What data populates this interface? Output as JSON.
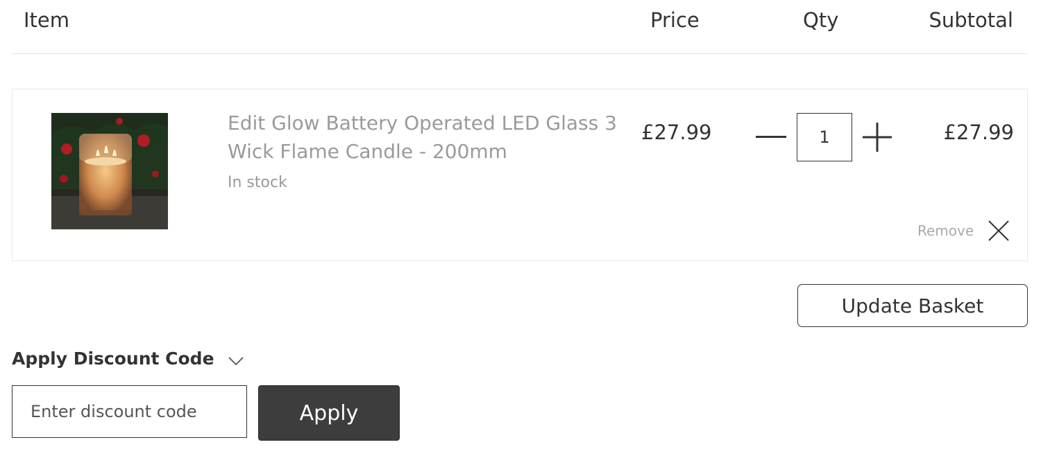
{
  "table_header": {
    "item": "Item",
    "price": "Price",
    "qty": "Qty",
    "subtotal": "Subtotal"
  },
  "cart": {
    "items": [
      {
        "name": "Edit Glow Battery Operated LED Glass 3 Wick Flame Candle - 200mm",
        "stock_status": "In stock",
        "price": "£27.99",
        "quantity": "1",
        "subtotal": "£27.99",
        "remove_label": "Remove",
        "image_icon": "candle-product-photo"
      }
    ]
  },
  "actions": {
    "update_basket_label": "Update Basket"
  },
  "discount": {
    "title": "Apply Discount Code",
    "placeholder": "Enter discount code",
    "apply_label": "Apply"
  },
  "colors": {
    "apply_button_bg": "#3d3d3d",
    "text": "#333333",
    "muted_text": "#9a9a9a",
    "border": "#e8e8e8"
  }
}
